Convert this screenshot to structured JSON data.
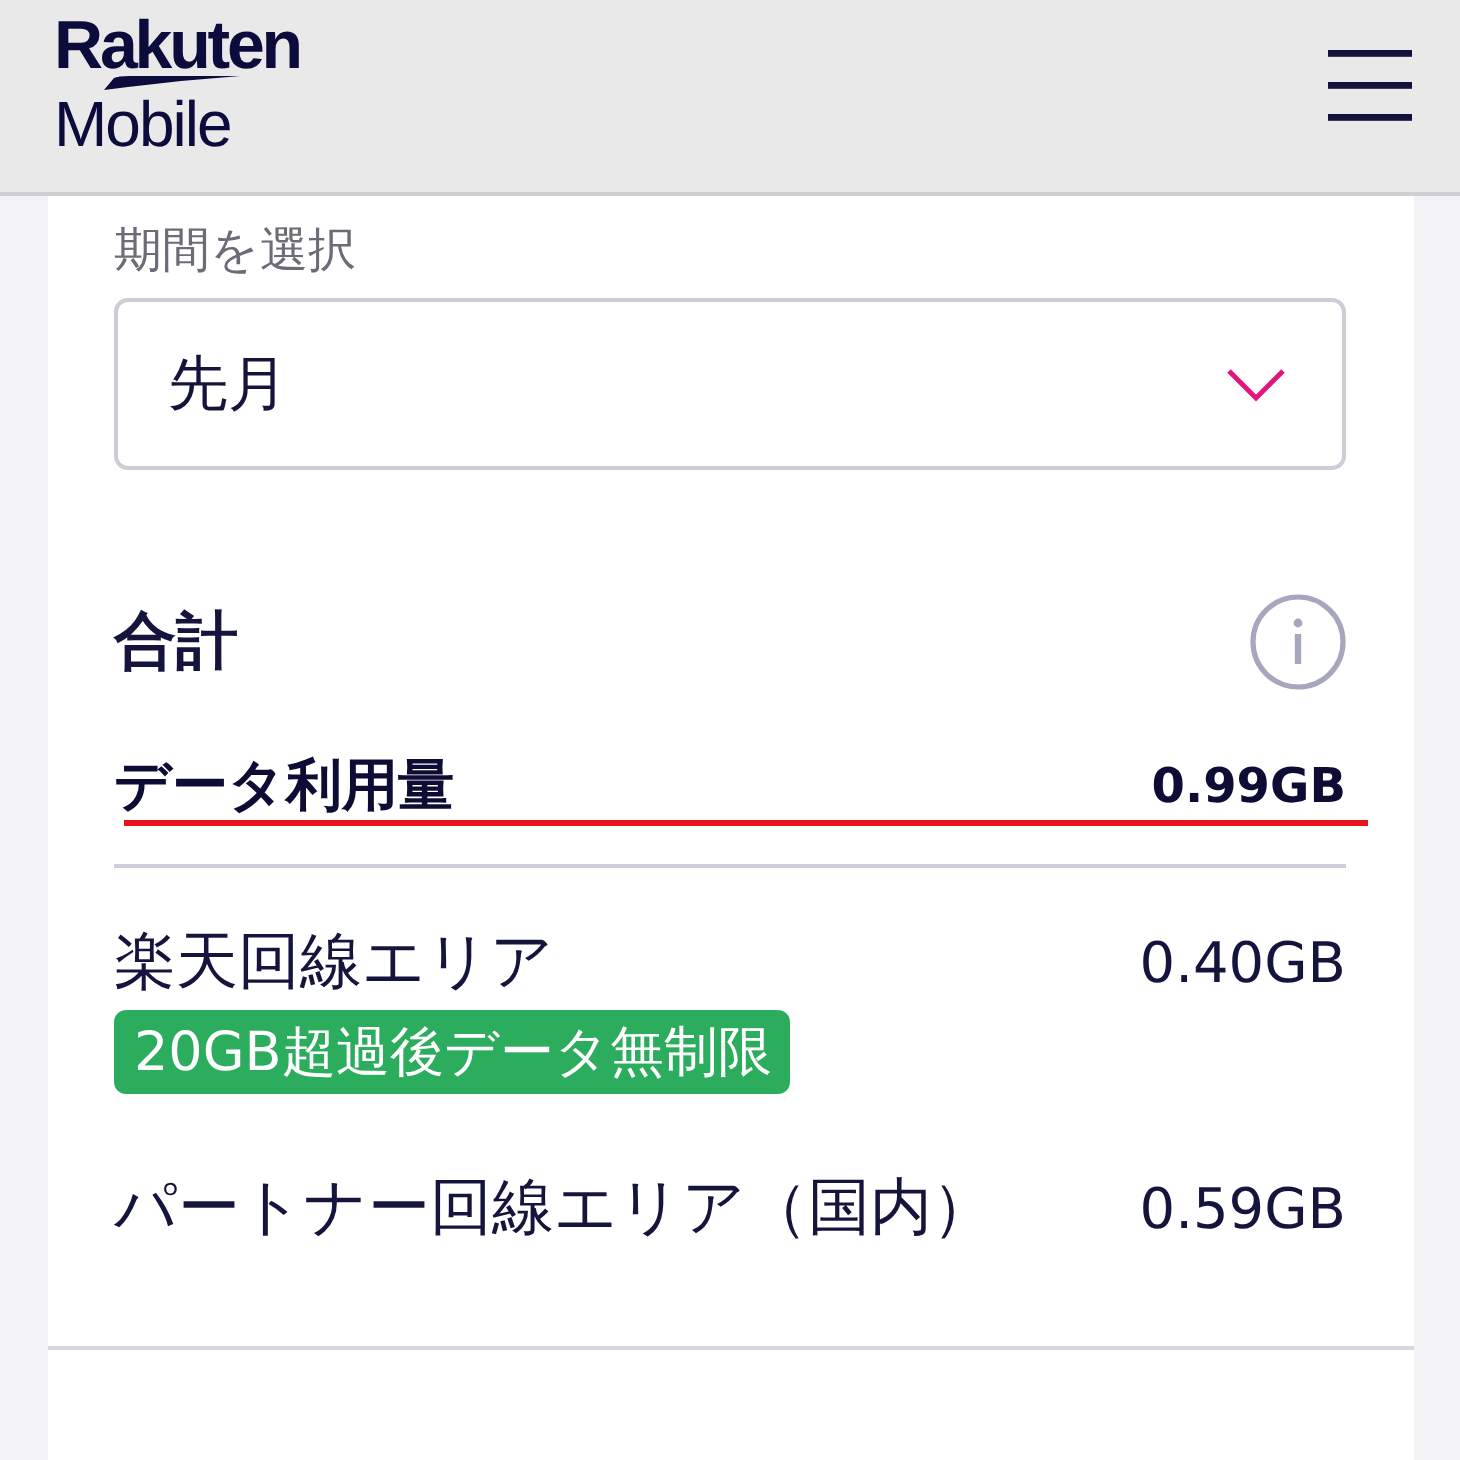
{
  "header": {
    "logo": {
      "brand": "Rakuten",
      "product": "Mobile"
    }
  },
  "period": {
    "label": "期間を選択",
    "value": "先月"
  },
  "total": {
    "title": "合計",
    "summary": {
      "label": "データ利用量",
      "value": "0.99GB",
      "underlined": true
    },
    "breakdown": [
      {
        "label": "楽天回線エリア",
        "value": "0.40GB",
        "badge": "20GB超過後データ無制限"
      },
      {
        "label": "パートナー回線エリア（国内）",
        "value": "0.59GB"
      }
    ]
  }
}
